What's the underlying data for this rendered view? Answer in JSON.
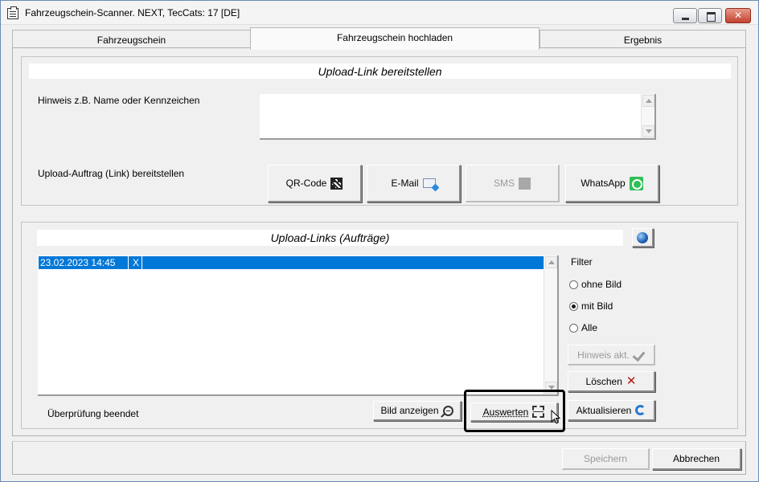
{
  "window": {
    "title": "Fahrzeugschein-Scanner. NEXT, TecCats: 17 [DE]"
  },
  "tabs": [
    {
      "label": "Fahrzeugschein",
      "active": false
    },
    {
      "label": "Fahrzeugschein hochladen",
      "active": true
    },
    {
      "label": "Ergebnis",
      "active": false
    }
  ],
  "upload_link": {
    "section_title": "Upload-Link bereitstellen",
    "hint_label": "Hinweis z.B. Name oder Kennzeichen",
    "hint_value": "",
    "provide_label": "Upload-Auftrag (Link) bereitstellen",
    "buttons": {
      "qr_code": "QR-Code",
      "email": "E-Mail",
      "sms": "SMS",
      "whatsapp": "WhatsApp"
    }
  },
  "upload_links": {
    "section_title": "Upload-Links (Aufträge)",
    "rows": [
      {
        "date": "23.02.2023 14:45",
        "flag": "X",
        "selected": true
      }
    ],
    "filter": {
      "label": "Filter",
      "options": [
        "ohne Bild",
        "mit Bild",
        "Alle"
      ],
      "selected": "mit Bild"
    },
    "buttons": {
      "hinweis_akt": "Hinweis akt.",
      "loeschen": "Löschen",
      "aktualisieren": "Aktualisieren",
      "bild_anzeigen": "Bild anzeigen",
      "auswerten": "Auswerten"
    },
    "status": "Überprüfung beendet"
  },
  "footer": {
    "speichern": "Speichern",
    "abbrechen": "Abbrechen"
  },
  "colors": {
    "selection": "#0078d7",
    "highlight_box": "#000000",
    "whatsapp_green": "#2fbf55",
    "delete_red": "#b01818"
  }
}
